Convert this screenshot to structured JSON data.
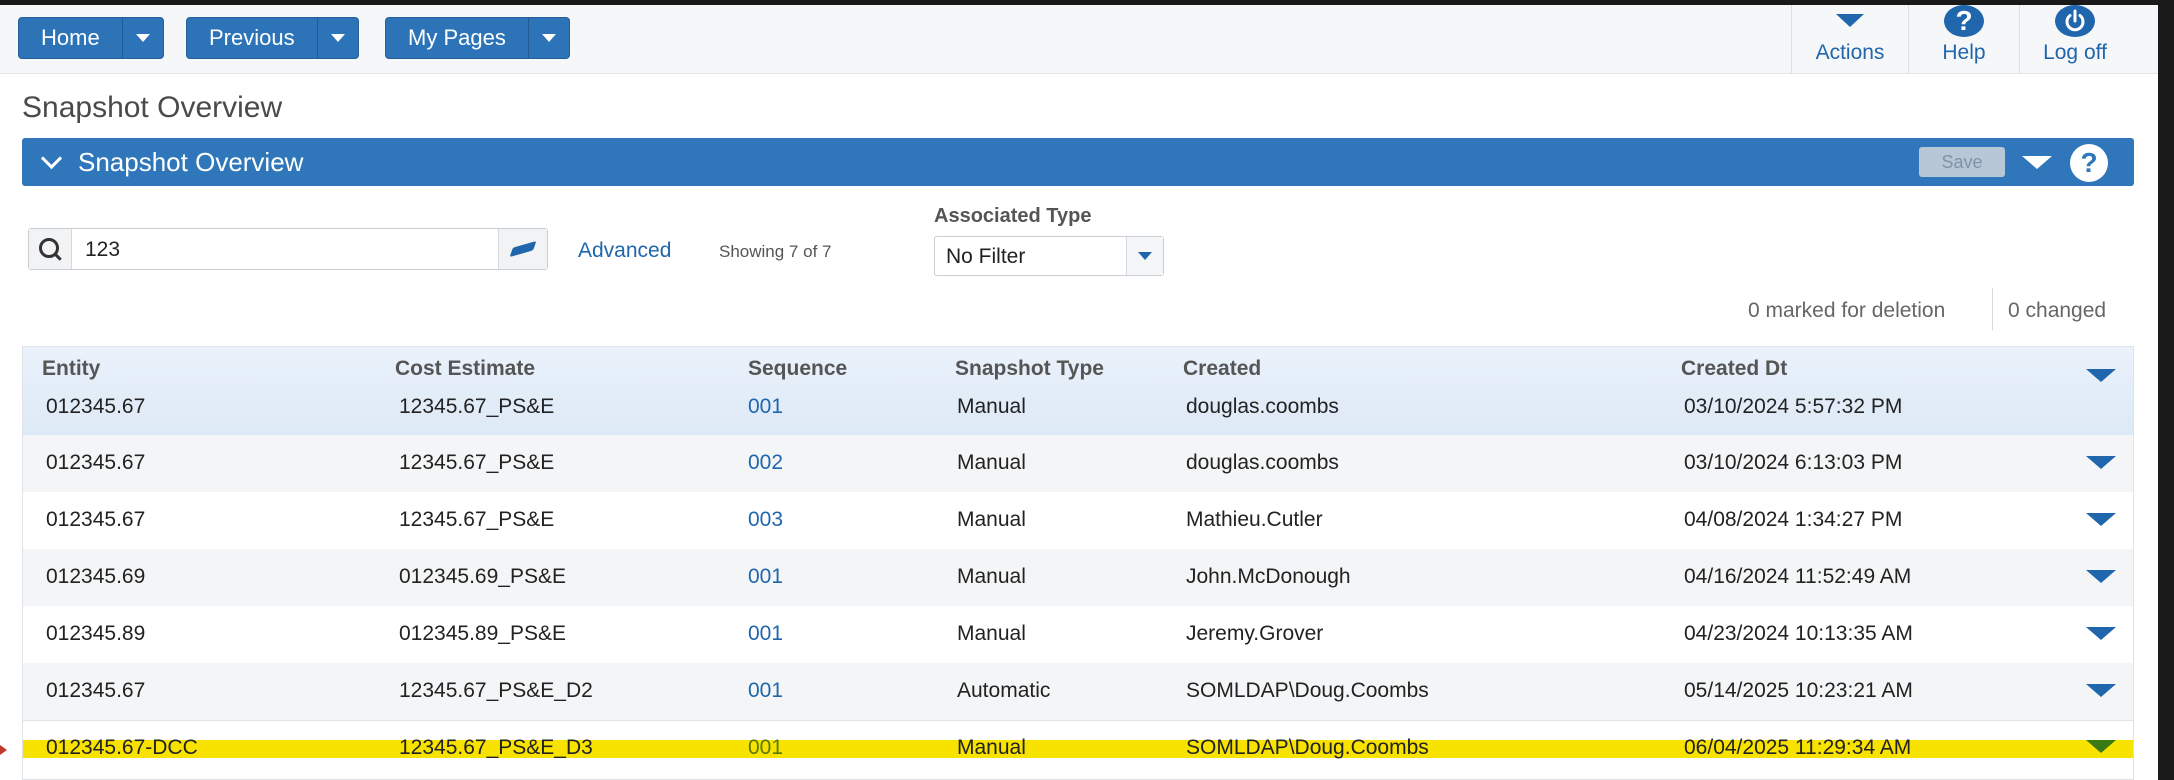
{
  "nav": {
    "home": "Home",
    "previous": "Previous",
    "my_pages": "My Pages"
  },
  "toolbar": {
    "actions": "Actions",
    "help": "Help",
    "logoff": "Log off"
  },
  "page": {
    "title": "Snapshot Overview"
  },
  "section": {
    "title": "Snapshot Overview",
    "save": "Save"
  },
  "search": {
    "value": "123",
    "advanced": "Advanced",
    "showing": "Showing 7 of 7"
  },
  "filter": {
    "label": "Associated Type",
    "value": "No Filter"
  },
  "counts": {
    "deletion": "0 marked for deletion",
    "changed": "0 changed"
  },
  "table": {
    "columns": [
      "Entity",
      "Cost Estimate",
      "Sequence",
      "Snapshot Type",
      "Created",
      "Created Dt"
    ],
    "rows": [
      {
        "entity": "012345.67",
        "estimate": "12345.67_PS&E",
        "sequence": "001",
        "type": "Manual",
        "created": "douglas.coombs",
        "created_dt": "03/10/2024 5:57:32 PM"
      },
      {
        "entity": "012345.67",
        "estimate": "12345.67_PS&E",
        "sequence": "002",
        "type": "Manual",
        "created": "douglas.coombs",
        "created_dt": "03/10/2024 6:13:03 PM"
      },
      {
        "entity": "012345.67",
        "estimate": "12345.67_PS&E",
        "sequence": "003",
        "type": "Manual",
        "created": "Mathieu.Cutler",
        "created_dt": "04/08/2024 1:34:27 PM"
      },
      {
        "entity": "012345.69",
        "estimate": "012345.69_PS&E",
        "sequence": "001",
        "type": "Manual",
        "created": "John.McDonough",
        "created_dt": "04/16/2024 11:52:49 AM"
      },
      {
        "entity": "012345.89",
        "estimate": "012345.89_PS&E",
        "sequence": "001",
        "type": "Manual",
        "created": "Jeremy.Grover",
        "created_dt": "04/23/2024 10:13:35 AM"
      },
      {
        "entity": "012345.67",
        "estimate": "12345.67_PS&E_D2",
        "sequence": "001",
        "type": "Automatic",
        "created": "SOMLDAP\\Doug.Coombs",
        "created_dt": "05/14/2025 10:23:21 AM"
      },
      {
        "entity": "012345.67-DCC",
        "estimate": "12345.67_PS&E_D3",
        "sequence": "001",
        "type": "Manual",
        "created": "SOMLDAP\\Doug.Coombs",
        "created_dt": "06/04/2025 11:29:34 AM"
      }
    ]
  },
  "colors": {
    "primary": "#2f77ba",
    "link": "#1f66ad",
    "highlight": "#f7e200"
  }
}
